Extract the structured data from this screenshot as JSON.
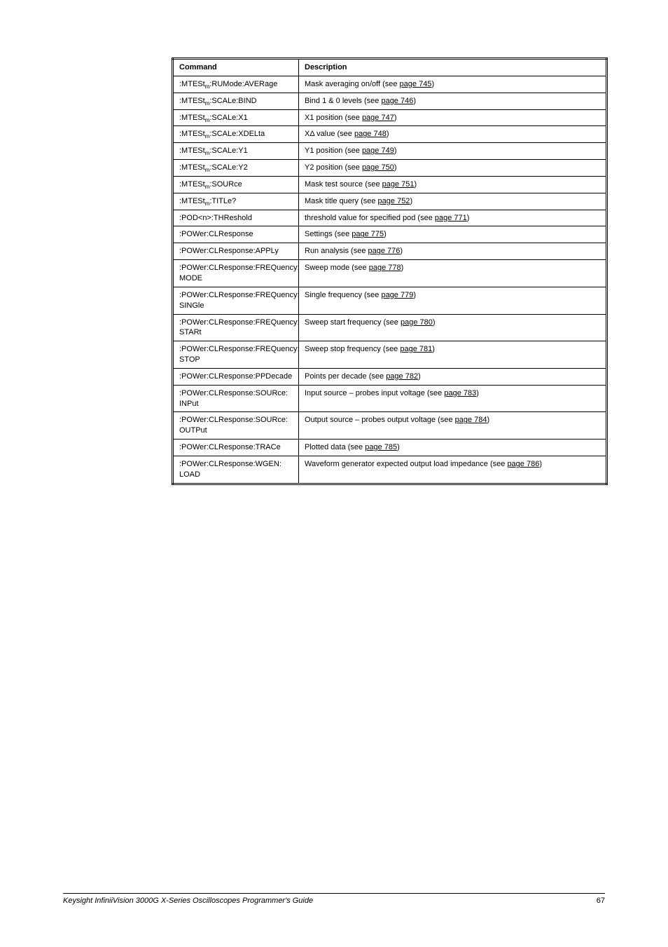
{
  "table": {
    "headers": {
      "c1": "Command",
      "c2": "Description"
    },
    "rows": [
      {
        "c1_html": ":MTESt<span class='sub'>m</span>:RUMode:AVERage",
        "c2_plain_pre": "Mask averaging on/off (see ",
        "c2_link": "page 745",
        "c2_plain_post": ")"
      },
      {
        "c1_html": ":MTESt<span class='sub'>m</span>:SCALe:BIND",
        "c2_plain_pre": "Bind 1 & 0 levels (see ",
        "c2_link": "page 746",
        "c2_plain_post": ")"
      },
      {
        "c1_html": ":MTESt<span class='sub'>m</span>:SCALe:X1",
        "c2_plain_pre": "X1 position (see ",
        "c2_link": "page 747",
        "c2_plain_post": ")"
      },
      {
        "c1_html": ":MTESt<span class='sub'>m</span>:SCALe:XDELta",
        "c2_plain_pre": "XΔ value (see ",
        "c2_link": "page 748",
        "c2_plain_post": ")"
      },
      {
        "c1_html": ":MTESt<span class='sub'>m</span>:SCALe:Y1",
        "c2_plain_pre": "Y1 position (see ",
        "c2_link": "page 749",
        "c2_plain_post": ")"
      },
      {
        "c1_html": ":MTESt<span class='sub'>m</span>:SCALe:Y2",
        "c2_plain_pre": "Y2 position (see ",
        "c2_link": "page 750",
        "c2_plain_post": ")"
      },
      {
        "c1_html": ":MTESt<span class='sub'>m</span>:SOURce",
        "c2_plain_pre": "Mask test source (see ",
        "c2_link": "page 751",
        "c2_plain_post": ")"
      },
      {
        "c1_html": ":MTESt<span class='sub'>m</span>:TITLe?",
        "c2_plain_pre": "Mask title query (see ",
        "c2_link": "page 752",
        "c2_plain_post": ")"
      },
      {
        "c1_html": ":POD&lt;n&gt;:THReshold",
        "c2_plain_pre": "threshold value for specified pod (see ",
        "c2_link": "page 771",
        "c2_plain_post": ")"
      },
      {
        "c1_html": ":POWer:CLResponse",
        "c2_plain_pre": "Settings (see ",
        "c2_link": "page 775",
        "c2_plain_post": ")"
      },
      {
        "c1_html": ":POWer:CLResponse:APPLy",
        "c2_plain_pre": "Run analysis (see ",
        "c2_link": "page 776",
        "c2_plain_post": ")"
      },
      {
        "c1_html": "<span class='line-tight'>:POWer:CLResponse:FREQuency:<br>MODE</span>",
        "c2_plain_pre": "Sweep mode (see ",
        "c2_link": "page 778",
        "c2_plain_post": ")"
      },
      {
        "c1_html": "<span class='line-tight'>:POWer:CLResponse:FREQuency:<br>SINGle</span>",
        "c2_plain_pre": "Single frequency (see ",
        "c2_link": "page 779",
        "c2_plain_post": ")"
      },
      {
        "c1_html": "<span class='line-tight'>:POWer:CLResponse:FREQuency:<br>STARt</span>",
        "c2_plain_pre": "Sweep start frequency (see ",
        "c2_link": "page 780",
        "c2_plain_post": ")"
      },
      {
        "c1_html": "<span class='line-tight'>:POWer:CLResponse:FREQuency:<br>STOP</span>",
        "c2_plain_pre": "Sweep stop frequency (see ",
        "c2_link": "page 781",
        "c2_plain_post": ")"
      },
      {
        "c1_html": ":POWer:CLResponse:PPDecade",
        "c2_plain_pre": "Points per decade (see ",
        "c2_link": "page 782",
        "c2_plain_post": ")"
      },
      {
        "c1_html": "<span class='line-tight'>:POWer:CLResponse:SOURce:<br>INPut</span>",
        "c2_plain_pre": "Input source – probes input voltage (see ",
        "c2_link": "page 783",
        "c2_plain_post": ")"
      },
      {
        "c1_html": "<span class='line-tight'>:POWer:CLResponse:SOURce:<br>OUTPut</span>",
        "c2_plain_pre": "Output source – probes output voltage (see ",
        "c2_link": "page 784",
        "c2_plain_post": ")"
      },
      {
        "c1_html": ":POWer:CLResponse:TRACe",
        "c2_plain_pre": "Plotted data (see ",
        "c2_link": "page 785",
        "c2_plain_post": ")"
      },
      {
        "c1_html": "<span class='line-tight'>:POWer:CLResponse:WGEN:<br>LOAD</span>",
        "c2_plain_pre": "Waveform generator expected output load impedance (see ",
        "c2_link": "page 786",
        "c2_plain_post": ")"
      }
    ]
  },
  "footer": {
    "left": "Keysight InfiniiVision 3000G X-Series Oscilloscopes Programmer's Guide",
    "right": "67"
  }
}
